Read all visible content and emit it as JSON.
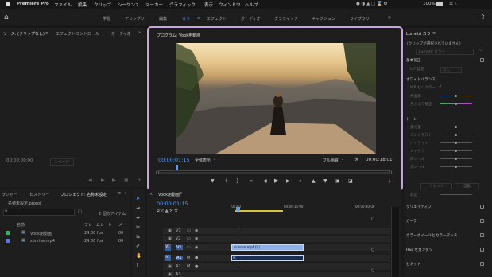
{
  "menubar": {
    "app": "Premiere Pro",
    "items": [
      "ファイル",
      "編集",
      "クリップ",
      "シーケンス",
      "マーカー",
      "グラフィック",
      "表示",
      "ウィンドウ",
      "ヘルプ"
    ],
    "battery": "100%"
  },
  "workspaces": [
    "学習",
    "アセンブリ",
    "編集",
    "カラー",
    "エフェクト",
    "オーディオ",
    "グラフィック",
    "キャプション",
    "ライブラリ"
  ],
  "source": {
    "tab1": "ソース: (クリップなし)",
    "tab2": "エフェクトコントロール",
    "tab3": "オーディオ",
    "timecode": "00;00;00;00",
    "page": "1ページ"
  },
  "program": {
    "title": "プログラム: Vook用動画",
    "timecode": "00:00:01:15",
    "fit": "全体表示",
    "quality": "フル画質",
    "duration": "00:00:18:01"
  },
  "lumetri": {
    "title": "Lumetri カラー",
    "clip": "(クリップが選択されていません)",
    "select": "Lumetri カラー",
    "basic": "基本補正",
    "lut": "LUT設定",
    "lut_val": "なし",
    "wb": "ホワイトバランス",
    "wb_sel": "WB セレクター",
    "temp": "色温度",
    "tint": "色かぶり補正",
    "tone": "トーン",
    "tone_rows": [
      "露光量",
      "コントラスト",
      "ハイライト",
      "シャドウ",
      "白レベル",
      "黒レベル"
    ],
    "reset": "リセット",
    "auto": "自動",
    "saturation": "彩度",
    "sections": [
      "クリエイティブ",
      "カーブ",
      "カラーホイールとカラーマッチ",
      "HSL セカンダリ",
      "ビネット"
    ]
  },
  "project": {
    "tabs": [
      "ラジャー",
      "ヒストリー",
      "プロジェクト: 名称未設定"
    ],
    "file": "名称未設定.prproj",
    "search_placeholder": "",
    "count": "2 個のアイテム",
    "col_name": "名前",
    "col_rate": "フレームレート",
    "col_media": "メ",
    "items": [
      {
        "name": "Vook用動画",
        "rate": "24.00 fps",
        "color": "#35b35a"
      },
      {
        "name": "sunrise.mp4",
        "rate": "24.00 fps",
        "color": "#5a78d8"
      }
    ]
  },
  "timeline": {
    "tab": "Vook用動画",
    "timecode": "00:00:01:15",
    "ruler": [
      ":00:00",
      "00:00:15:00",
      "00:00:30:00"
    ],
    "video_tracks": [
      "V3",
      "V2",
      "V1"
    ],
    "audio_tracks": [
      "A1",
      "A2",
      "A3"
    ],
    "clip_label": "sunrise.mp4 [V]"
  },
  "colors": {
    "accent": "#5b9cf6",
    "highlight": "#c9a3e0"
  }
}
